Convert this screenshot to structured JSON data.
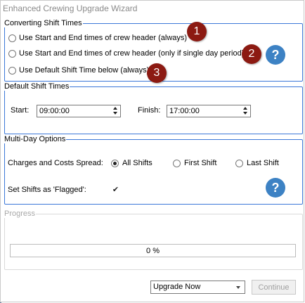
{
  "window": {
    "title": "Enhanced Crewing Upgrade Wizard"
  },
  "converting": {
    "legend": "Converting Shift Times",
    "options": [
      {
        "label": "Use Start and End times of crew header (always)",
        "badge": "1",
        "checked": false
      },
      {
        "label": "Use Start and End times of crew header (only if single day period)",
        "badge": "2",
        "checked": false
      },
      {
        "label": "Use Default Shift Time below (always)",
        "badge": "3",
        "checked": false
      }
    ],
    "help_icon": "question-icon"
  },
  "default_times": {
    "legend": "Default Shift Times",
    "start_label": "Start:",
    "start_value": "09:00:00",
    "finish_label": "Finish:",
    "finish_value": "17:00:00"
  },
  "multiday": {
    "legend": "Multi-Day Options",
    "spread_label": "Charges and Costs Spread:",
    "spread_options": [
      {
        "label": "All Shifts",
        "checked": true
      },
      {
        "label": "First Shift",
        "checked": false
      },
      {
        "label": "Last Shift",
        "checked": false
      }
    ],
    "flagged_label": "Set Shifts as 'Flagged':",
    "flagged_checked": true,
    "help_icon": "question-icon"
  },
  "progress": {
    "legend": "Progress",
    "value_text": "0 %",
    "percent": 0
  },
  "footer": {
    "mode_select": "Upgrade Now",
    "continue_label": "Continue"
  },
  "colors": {
    "group_border": "#3c78d8",
    "badge": "#8c1a12",
    "help": "#3d82c4"
  }
}
